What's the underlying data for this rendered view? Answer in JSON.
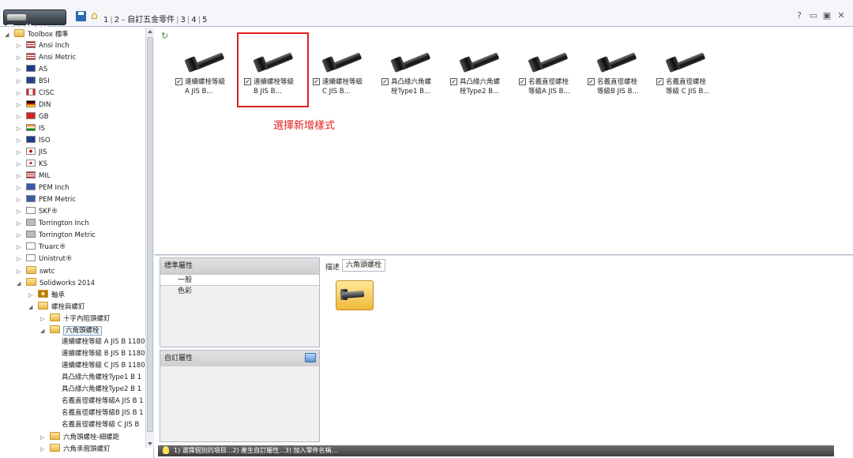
{
  "titlebar": {
    "brand": "Toolbox",
    "crumbs": [
      "1",
      "2 - 自訂五金零件",
      "3",
      "4",
      "5"
    ],
    "controls": [
      "?",
      "▭",
      "▣",
      "✕"
    ]
  },
  "tree": {
    "items": [
      {
        "label": "Toolbox 標準",
        "level": 0,
        "exp": "◢",
        "icon": "folder"
      },
      {
        "label": "Ansi Inch",
        "level": 1,
        "exp": "▷",
        "icon": "flag-us"
      },
      {
        "label": "Ansi Metric",
        "level": 1,
        "exp": "▷",
        "icon": "flag-us"
      },
      {
        "label": "AS",
        "level": 1,
        "exp": "▷",
        "icon": "flag-au"
      },
      {
        "label": "BSI",
        "level": 1,
        "exp": "▷",
        "icon": "flag-uk"
      },
      {
        "label": "CISC",
        "level": 1,
        "exp": "▷",
        "icon": "flag-ca"
      },
      {
        "label": "DIN",
        "level": 1,
        "exp": "▷",
        "icon": "flag-de"
      },
      {
        "label": "GB",
        "level": 1,
        "exp": "▷",
        "icon": "flag-cn"
      },
      {
        "label": "IS",
        "level": 1,
        "exp": "▷",
        "icon": "flag-in"
      },
      {
        "label": "ISO",
        "level": 1,
        "exp": "▷",
        "icon": "flag-iso"
      },
      {
        "label": "JIS",
        "level": 1,
        "exp": "▷",
        "icon": "flag-jp"
      },
      {
        "label": "KS",
        "level": 1,
        "exp": "▷",
        "icon": "flag-kr"
      },
      {
        "label": "MIL",
        "level": 1,
        "exp": "▷",
        "icon": "flag-us"
      },
      {
        "label": "PEM Inch",
        "level": 1,
        "exp": "▷",
        "icon": "pem-logo"
      },
      {
        "label": "PEM Metric",
        "level": 1,
        "exp": "▷",
        "icon": "pem-logo"
      },
      {
        "label": "SKF®",
        "level": 1,
        "exp": "▷",
        "icon": "skf-logo"
      },
      {
        "label": "Torrington Inch",
        "level": 1,
        "exp": "▷",
        "icon": "torrington-logo"
      },
      {
        "label": "Torrington Metric",
        "level": 1,
        "exp": "▷",
        "icon": "torrington-logo"
      },
      {
        "label": "Truarc®",
        "level": 1,
        "exp": "▷",
        "icon": "truarc-logo"
      },
      {
        "label": "Unistrut®",
        "level": 1,
        "exp": "▷",
        "icon": "unistrut-logo"
      },
      {
        "label": "swtc",
        "level": 1,
        "exp": "▷",
        "icon": "folder"
      },
      {
        "label": "Solidworks 2014",
        "level": 1,
        "exp": "◢",
        "icon": "folder"
      },
      {
        "label": "軸承",
        "level": 2,
        "exp": "▷",
        "icon": "bearing"
      },
      {
        "label": "螺栓與螺釘",
        "level": 2,
        "exp": "◢",
        "icon": "folder"
      },
      {
        "label": "十字內陷頭螺釘",
        "level": 3,
        "exp": "▷",
        "icon": "folder"
      },
      {
        "label": "六角頭螺栓",
        "level": 3,
        "exp": "◢",
        "icon": "folder",
        "selected": true
      },
      {
        "label": "連續螺栓等級 A  JIS B 1180",
        "level": 4,
        "exp": "",
        "icon": "none"
      },
      {
        "label": "連續螺栓等級 B  JIS B 1180",
        "level": 4,
        "exp": "",
        "icon": "none"
      },
      {
        "label": "連續螺栓等級 C  JIS B 1180",
        "level": 4,
        "exp": "",
        "icon": "none"
      },
      {
        "label": "具凸緣六角螺栓Type1  B 1",
        "level": 4,
        "exp": "",
        "icon": "none"
      },
      {
        "label": "具凸緣六角螺栓Type2  B 1",
        "level": 4,
        "exp": "",
        "icon": "none"
      },
      {
        "label": "名義直徑螺栓等級A  JIS B 1",
        "level": 4,
        "exp": "",
        "icon": "none"
      },
      {
        "label": "名義直徑螺栓等級B  JIS B 1",
        "level": 4,
        "exp": "",
        "icon": "none"
      },
      {
        "label": "名義直徑螺栓等級 C  JIS B",
        "level": 4,
        "exp": "",
        "icon": "none"
      },
      {
        "label": "六角頭螺栓-細螺距",
        "level": 3,
        "exp": "▷",
        "icon": "folder"
      },
      {
        "label": "六角承窩頭螺釘",
        "level": 3,
        "exp": "▷",
        "icon": "folder"
      }
    ]
  },
  "gallery": {
    "items": [
      {
        "line1": "連續螺栓等級",
        "line2": "A  JIS B...",
        "checked": "✓"
      },
      {
        "line1": "連續螺栓等級",
        "line2": "B  JIS B...",
        "checked": "✓"
      },
      {
        "line1": "連續螺栓等級",
        "line2": "C  JIS B...",
        "checked": "✓"
      },
      {
        "line1": "具凸緣六角螺",
        "line2": "栓Type1  B...",
        "checked": "✓"
      },
      {
        "line1": "具凸緣六角螺",
        "line2": "栓Type2  B...",
        "checked": "✓"
      },
      {
        "line1": "名義直徑螺栓",
        "line2": "等級A  JIS B...",
        "checked": "✓"
      },
      {
        "line1": "名義直徑螺栓",
        "line2": "等級B  JIS B...",
        "checked": "✓"
      },
      {
        "line1": "名義直徑螺栓",
        "line2": "等級 C  JIS B...",
        "checked": "✓"
      }
    ],
    "annotation": "選擇新增樣式"
  },
  "props": {
    "header": "標準屬性",
    "rows": [
      "一般",
      "色彩"
    ]
  },
  "custom": {
    "header": "自訂屬性"
  },
  "description": {
    "label": "描述",
    "value": "六角頭螺栓"
  },
  "status": {
    "text": "1) 選擇個別的項目...2) 產生自訂屬性...3) 加入零件名稱..."
  },
  "colors": {
    "highlight": "#e02020",
    "accent": "#2b67b3"
  }
}
